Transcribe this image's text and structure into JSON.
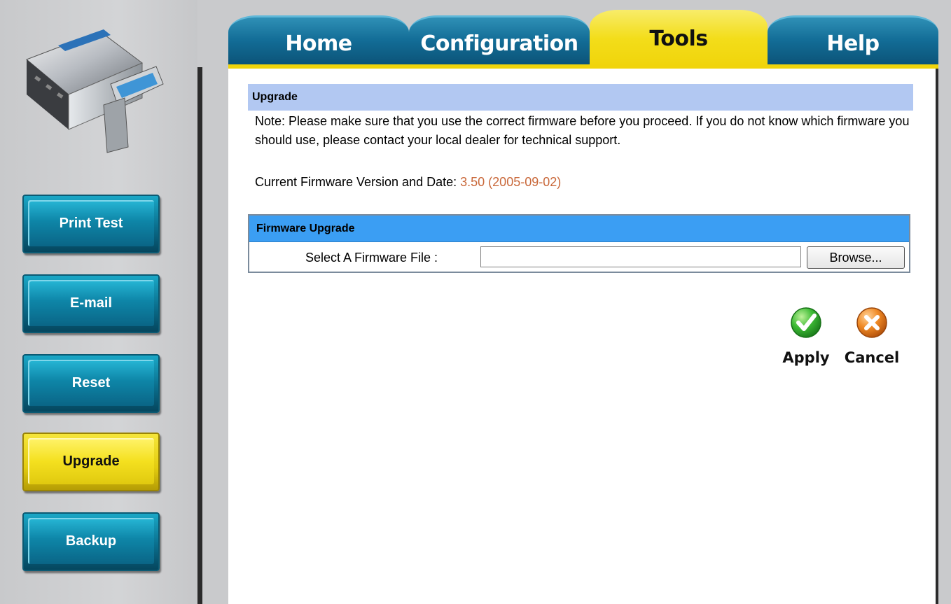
{
  "nav": {
    "tabs": [
      {
        "label": "Home",
        "active": false
      },
      {
        "label": "Configuration",
        "active": false
      },
      {
        "label": "Tools",
        "active": true
      },
      {
        "label": "Help",
        "active": false
      }
    ]
  },
  "sidebar": {
    "items": [
      {
        "label": "Print Test",
        "active": false
      },
      {
        "label": "E-mail",
        "active": false
      },
      {
        "label": "Reset",
        "active": false
      },
      {
        "label": "Upgrade",
        "active": true
      },
      {
        "label": "Backup",
        "active": false
      }
    ]
  },
  "upgrade": {
    "title": "Upgrade",
    "note": "Note: Please make sure that you use the correct firmware before you proceed. If you do not know which firmware you should use, please contact your local dealer for technical support.",
    "fw_label": "Current Firmware Version and Date:",
    "fw_value": "3.50 (2005-09-02)",
    "box_title": "Firmware Upgrade",
    "select_label": "Select A Firmware File :",
    "file_value": "",
    "browse_label": "Browse..."
  },
  "actions": {
    "apply_label": "Apply",
    "cancel_label": "Cancel"
  },
  "colors": {
    "tab_active": "#f0d40a",
    "tab_blue": "#126c96",
    "section_header": "#b2c8f2",
    "box_header": "#3b9ef3",
    "fw_value": "#c9683a",
    "apply_green": "#2fae2f",
    "cancel_orange": "#e87a1e"
  }
}
